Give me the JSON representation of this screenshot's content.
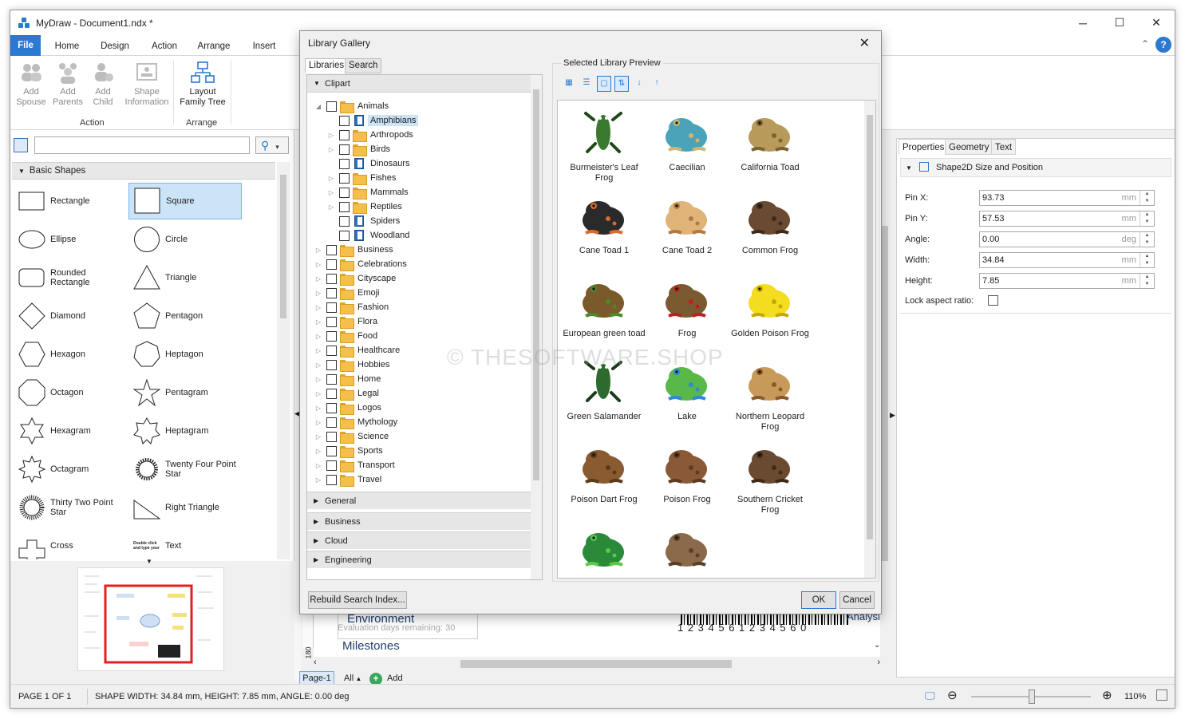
{
  "window": {
    "title": "MyDraw - Document1.ndx *",
    "minimize": "─",
    "maximize": "☐",
    "close": "✕"
  },
  "menu_tabs": [
    "File",
    "Home",
    "Design",
    "Action",
    "Arrange",
    "Insert"
  ],
  "ribbon": {
    "buttons": [
      {
        "label1": "Add",
        "label2": "Spouse",
        "enabled": false
      },
      {
        "label1": "Add",
        "label2": "Parents",
        "enabled": false
      },
      {
        "label1": "Add",
        "label2": "Child",
        "enabled": false
      },
      {
        "label1": "Shape",
        "label2": "Information",
        "enabled": false
      },
      {
        "label1": "Layout",
        "label2": "Family Tree",
        "enabled": true
      }
    ],
    "groups": [
      "Action",
      "Arrange"
    ]
  },
  "left_panel": {
    "search_placeholder": "",
    "section": "Basic Shapes",
    "shapes": [
      "Rectangle",
      "Square",
      "Ellipse",
      "Circle",
      "Rounded Rectangle",
      "Triangle",
      "Diamond",
      "Pentagon",
      "Hexagon",
      "Heptagon",
      "Octagon",
      "Pentagram",
      "Hexagram",
      "Heptagram",
      "Octagram",
      "Twenty Four Point Star",
      "Thirty Two Point Star",
      "Right Triangle",
      "Cross",
      "Text"
    ],
    "text_shape_hint": "Double click and type your"
  },
  "dialog": {
    "title": "Library Gallery",
    "tabs": [
      "Libraries",
      "Search"
    ],
    "root": "Clipart",
    "animals": "Animals",
    "animal_children": [
      "Amphibians",
      "Arthropods",
      "Birds",
      "Dinosaurs",
      "Fishes",
      "Mammals",
      "Reptiles",
      "Spiders",
      "Woodland"
    ],
    "folders": [
      "Business",
      "Celebrations",
      "Cityscape",
      "Emoji",
      "Fashion",
      "Flora",
      "Food",
      "Healthcare",
      "Hobbies",
      "Home",
      "Legal",
      "Logos",
      "Mythology",
      "Science",
      "Sports",
      "Transport",
      "Travel"
    ],
    "categories": [
      "General",
      "Business",
      "Cloud",
      "Engineering"
    ],
    "preview_label": "Selected Library Preview",
    "items": [
      "Burmeister's Leaf Frog",
      "Caecilian",
      "California Toad",
      "Cane Toad 1",
      "Cane Toad 2",
      "Common Frog",
      "European green toad",
      "Frog",
      "Golden Poison Frog",
      "Green Salamander",
      "Lake",
      "Northern Leopard Frog",
      "Poison Dart Frog",
      "Poison Frog",
      "Southern Cricket Frog",
      "",
      ""
    ],
    "rebuild": "Rebuild Search Index...",
    "ok": "OK",
    "cancel": "Cancel"
  },
  "properties": {
    "tabs": [
      "Properties",
      "Geometry",
      "Text"
    ],
    "section": "Shape2D Size and Position",
    "rows": [
      {
        "label": "Pin X:",
        "value": "93.73",
        "unit": "mm"
      },
      {
        "label": "Pin Y:",
        "value": "57.53",
        "unit": "mm"
      },
      {
        "label": "Angle:",
        "value": "0.00",
        "unit": "deg"
      },
      {
        "label": "Width:",
        "value": "34.84",
        "unit": "mm"
      },
      {
        "label": "Height:",
        "value": "7.85",
        "unit": "mm"
      }
    ],
    "lock_label": "Lock aspect ratio:"
  },
  "canvas": {
    "text1": "Environment",
    "eval": "Evaluation days remaining: 30",
    "text2": "Milestones",
    "barcode": "1 2 3 4 5 6 1 2 3 4 5 6 0",
    "analysis": "Analysi",
    "ruler": "180",
    "page_tab": "Page-1",
    "all": "All",
    "add": "Add"
  },
  "status": {
    "page": "PAGE 1 OF 1",
    "shape": "SHAPE WIDTH: 34.84 mm, HEIGHT: 7.85 mm, ANGLE: 0.00 deg",
    "zoom": "110%"
  },
  "watermark": "© THESOFTWARE.SHOP"
}
